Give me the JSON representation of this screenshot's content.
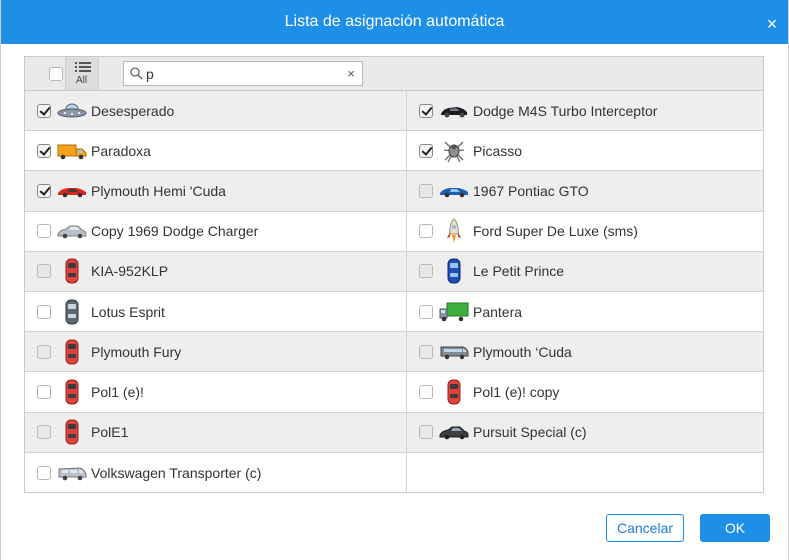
{
  "dialog": {
    "title": "Lista de asignación automática",
    "close_glyph": "×"
  },
  "toolbar": {
    "all_label": "All",
    "search_value": "p",
    "search_placeholder": "",
    "clear_glyph": "×"
  },
  "rows": [
    [
      {
        "label": "Desesperado",
        "checked": true,
        "icon": "ufo-icon"
      },
      {
        "label": "Dodge M4S Turbo Interceptor",
        "checked": true,
        "icon": "black-sports-car-icon"
      }
    ],
    [
      {
        "label": "Paradoxa",
        "checked": true,
        "icon": "orange-truck-icon"
      },
      {
        "label": "Picasso",
        "checked": true,
        "icon": "spider-icon"
      }
    ],
    [
      {
        "label": "Plymouth Hemi 'Cuda",
        "checked": true,
        "icon": "red-sports-car-icon"
      },
      {
        "label": "1967 Pontiac GTO",
        "checked": false,
        "icon": "blue-sports-car-icon"
      }
    ],
    [
      {
        "label": "Copy 1969 Dodge Charger",
        "checked": false,
        "icon": "silver-sedan-icon"
      },
      {
        "label": "Ford Super De Luxe (sms)",
        "checked": false,
        "icon": "rocket-icon"
      }
    ],
    [
      {
        "label": "KIA-952KLP",
        "checked": false,
        "icon": "red-car-topview-icon"
      },
      {
        "label": "Le Petit Prince",
        "checked": false,
        "icon": "blue-car-topview-icon"
      }
    ],
    [
      {
        "label": "Lotus Esprit",
        "checked": false,
        "icon": "gray-car-topview-icon"
      },
      {
        "label": "Pantera",
        "checked": false,
        "icon": "green-truck-icon"
      }
    ],
    [
      {
        "label": "Plymouth Fury",
        "checked": false,
        "icon": "red-car-topview-icon"
      },
      {
        "label": "Plymouth ‘Cuda",
        "checked": false,
        "icon": "bus-icon"
      }
    ],
    [
      {
        "label": "Pol1 (e)!",
        "checked": false,
        "icon": "red-car-topview-icon"
      },
      {
        "label": "Pol1 (e)! copy",
        "checked": false,
        "icon": "red-car-topview-icon"
      }
    ],
    [
      {
        "label": "PolE1",
        "checked": false,
        "icon": "red-car-topview-icon"
      },
      {
        "label": "Pursuit Special (c)",
        "checked": false,
        "icon": "dark-sedan-icon"
      }
    ],
    [
      {
        "label": "Volkswagen Transporter (c)",
        "checked": false,
        "icon": "silver-van-icon"
      },
      null
    ]
  ],
  "buttons": {
    "cancel": "Cancelar",
    "ok": "OK"
  },
  "colors": {
    "accent": "#1e8fe6",
    "row_alt": "#eeeeee"
  }
}
